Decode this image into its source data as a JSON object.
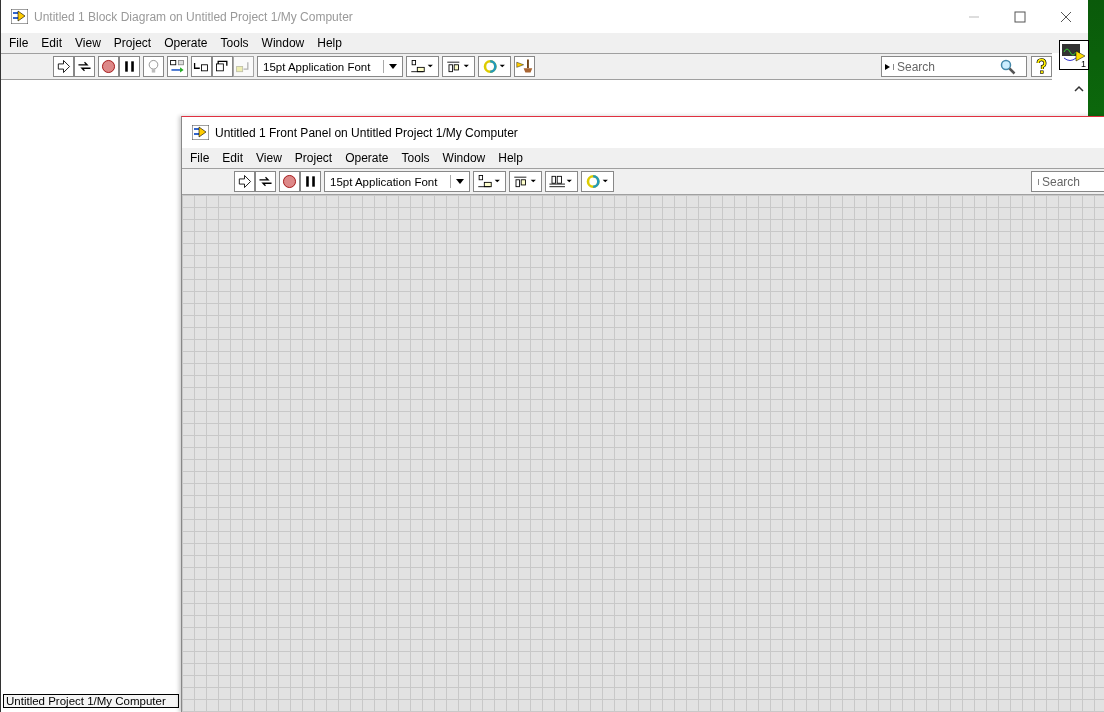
{
  "block_diagram": {
    "title": "Untitled 1 Block Diagram on Untitled Project 1/My Computer",
    "menu": [
      "File",
      "Edit",
      "View",
      "Project",
      "Operate",
      "Tools",
      "Window",
      "Help"
    ],
    "font_selector": "15pt Application Font",
    "search": {
      "placeholder": "Search"
    },
    "vi_icon_number": "1",
    "status_bar": "Untitled Project 1/My Computer"
  },
  "front_panel": {
    "title": "Untitled 1 Front Panel on Untitled Project 1/My Computer",
    "menu": [
      "File",
      "Edit",
      "View",
      "Project",
      "Operate",
      "Tools",
      "Window",
      "Help"
    ],
    "font_selector": "15pt Application Font",
    "search": {
      "placeholder": "Search"
    }
  }
}
